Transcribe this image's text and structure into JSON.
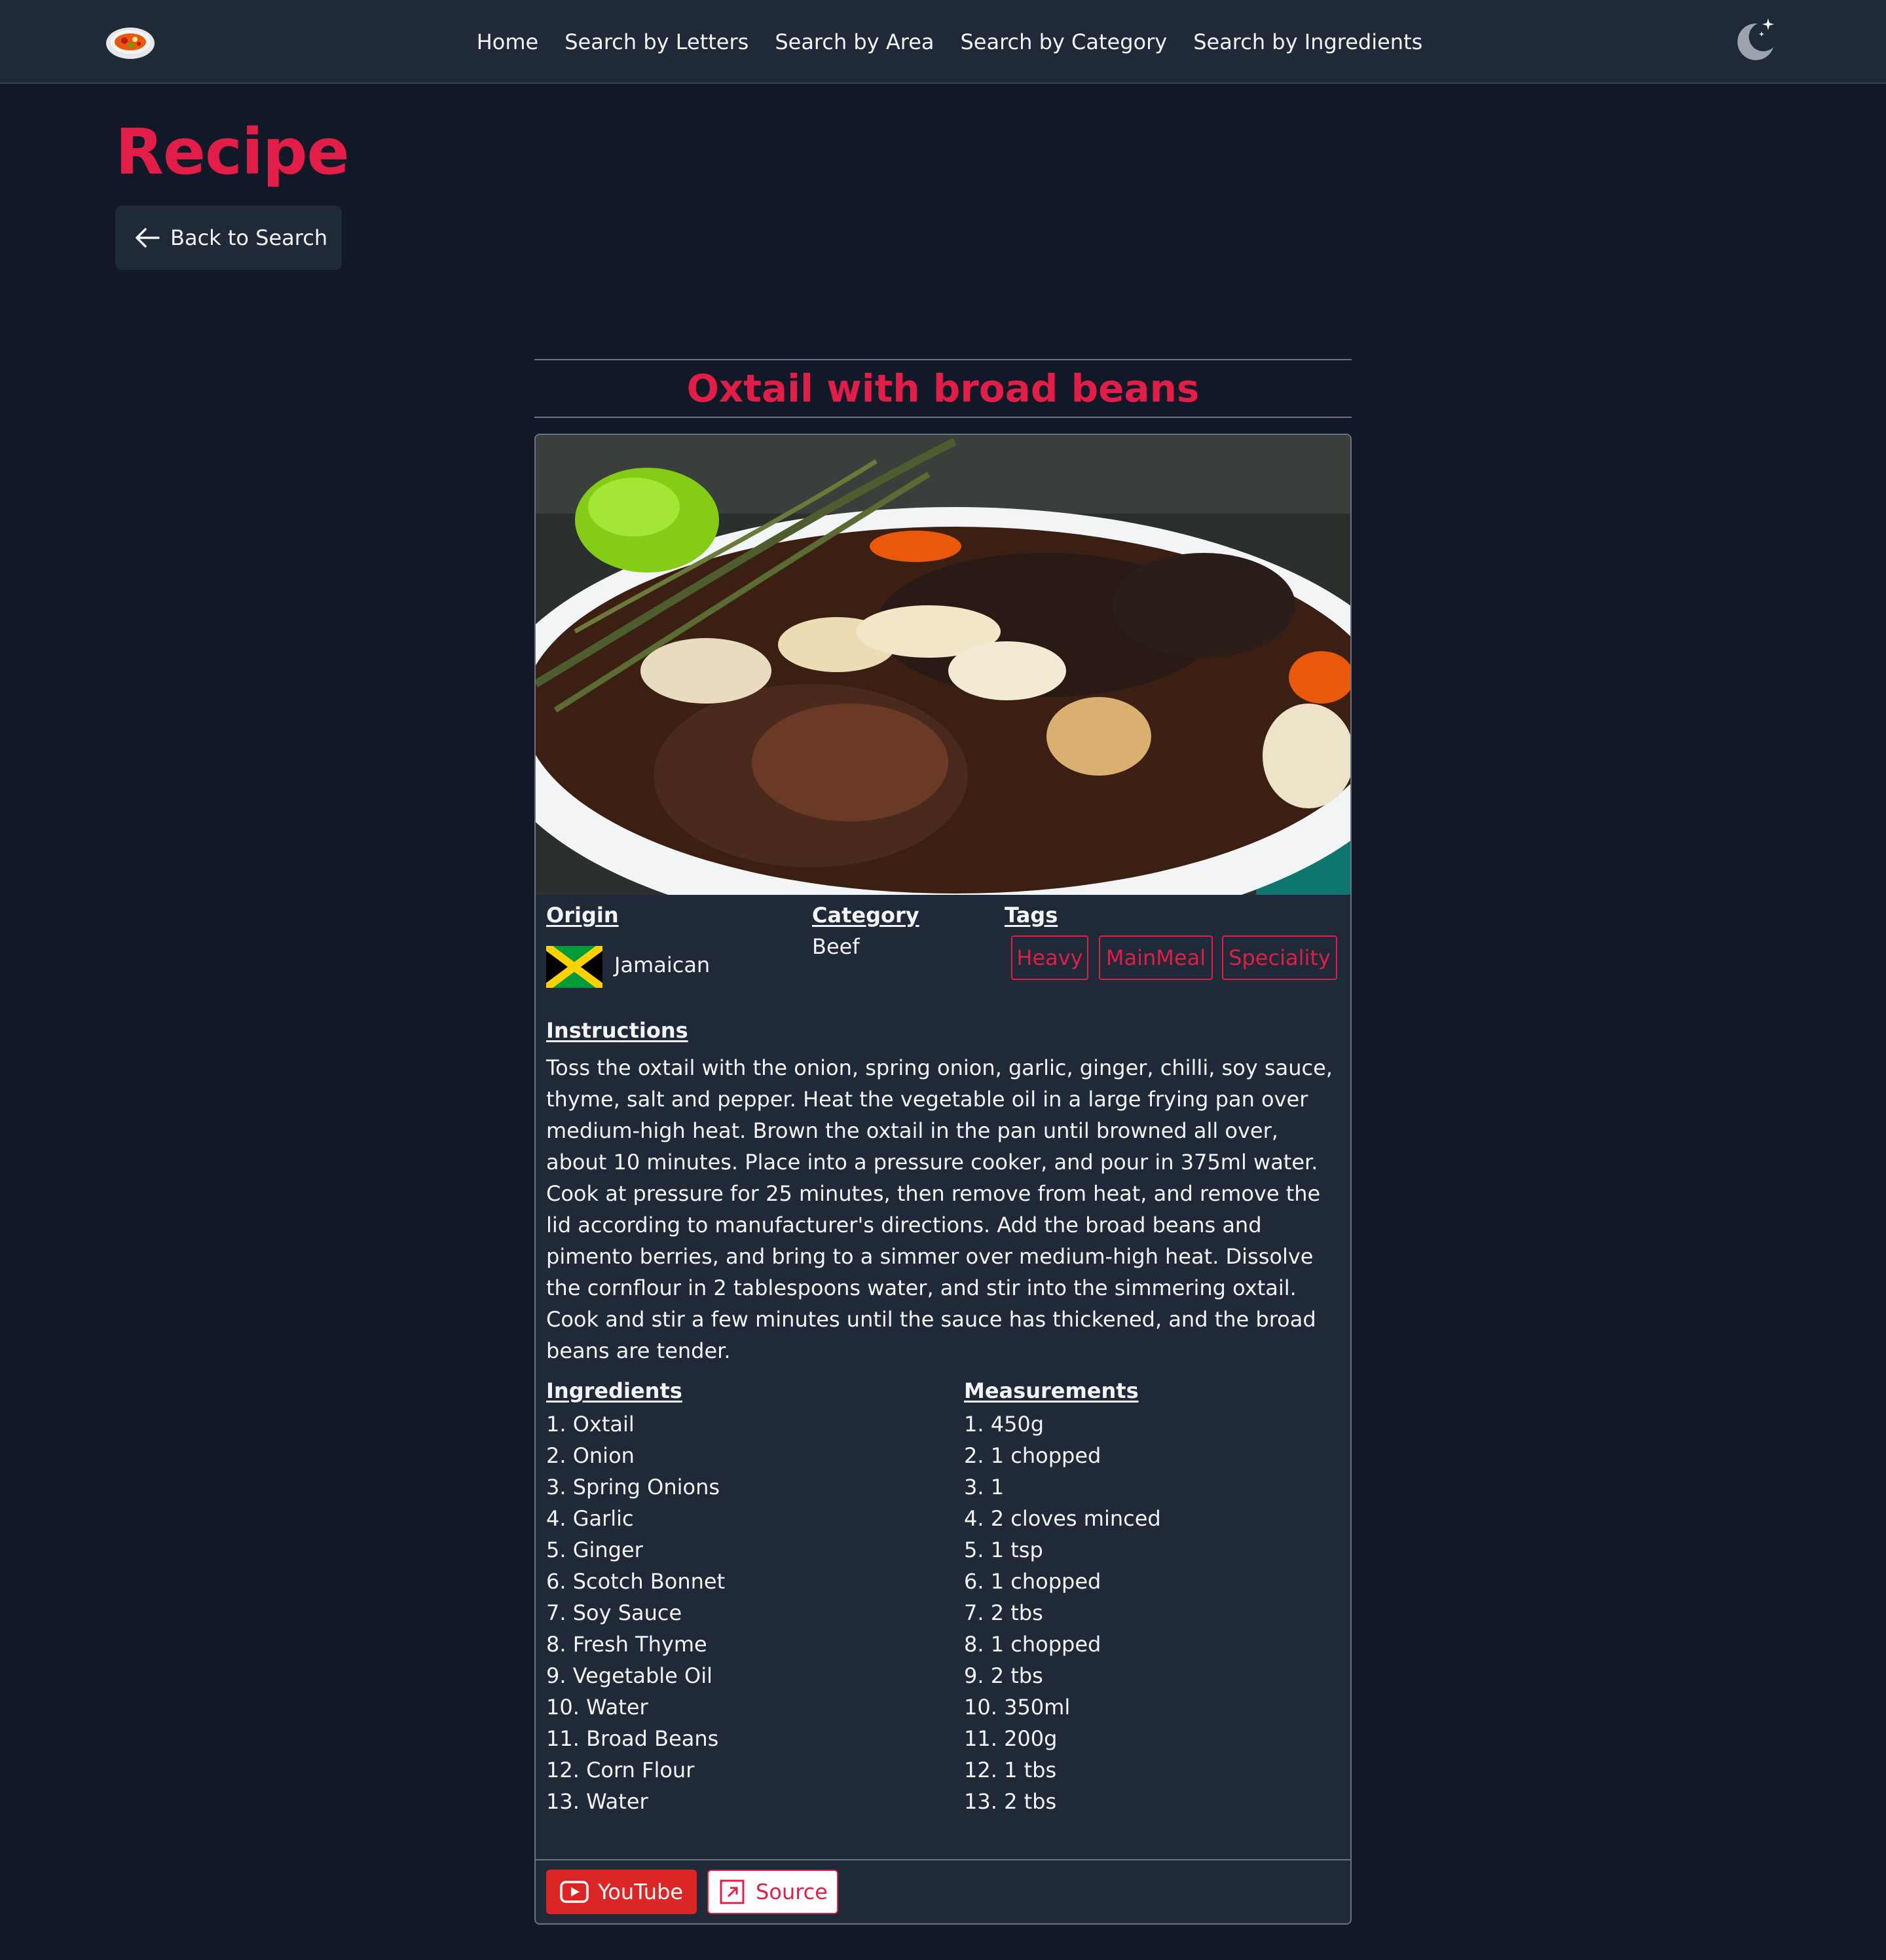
{
  "nav": {
    "links": [
      "Home",
      "Search by Letters",
      "Search by Area",
      "Search by Category",
      "Search by Ingredients"
    ],
    "logo_icon": "food-plate-icon",
    "theme_icon": "moon-sparkle-icon"
  },
  "header": {
    "title": "Recipe",
    "back_label": "Back to Search",
    "back_icon": "arrow-left-icon"
  },
  "recipe": {
    "name": "Oxtail with broad beans",
    "origin_label": "Origin",
    "origin": "Jamaican",
    "category_label": "Category",
    "category": "Beef",
    "tags_label": "Tags",
    "tags": [
      "Heavy",
      "MainMeal",
      "Speciality"
    ],
    "instructions_label": "Instructions",
    "instructions": "Toss the oxtail with the onion, spring onion, garlic, ginger, chilli, soy sauce, thyme, salt and pepper. Heat the vegetable oil in a large frying pan over medium-high heat. Brown the oxtail in the pan until browned all over, about 10 minutes. Place into a pressure cooker, and pour in 375ml water. Cook at pressure for 25 minutes, then remove from heat, and remove the lid according to manufacturer's directions. Add the broad beans and pimento berries, and bring to a simmer over medium-high heat. Dissolve the cornflour in 2 tablespoons water, and stir into the simmering oxtail. Cook and stir a few minutes until the sauce has thickened, and the broad beans are tender.",
    "ingredients_label": "Ingredients",
    "ingredients": [
      "1. Oxtail",
      "2. Onion",
      "3. Spring Onions",
      "4. Garlic",
      "5. Ginger",
      "6. Scotch Bonnet",
      "7. Soy Sauce",
      "8. Fresh Thyme",
      "9. Vegetable Oil",
      "10. Water",
      "11. Broad Beans",
      "12. Corn Flour",
      "13. Water"
    ],
    "measurements_label": "Measurements",
    "measurements": [
      "1. 450g",
      "2. 1 chopped",
      "3. 1",
      "4. 2 cloves minced",
      "5. 1 tsp",
      "6. 1 chopped",
      "7. 2 tbs",
      "8. 1 chopped",
      "9. 2 tbs",
      "10. 350ml",
      "11. 200g",
      "12. 1 tbs",
      "13. 2 tbs"
    ],
    "youtube_label": "YouTube",
    "source_label": "Source"
  },
  "colors": {
    "accent": "#e11d48",
    "background": "#111827",
    "surface": "#1f2937"
  }
}
